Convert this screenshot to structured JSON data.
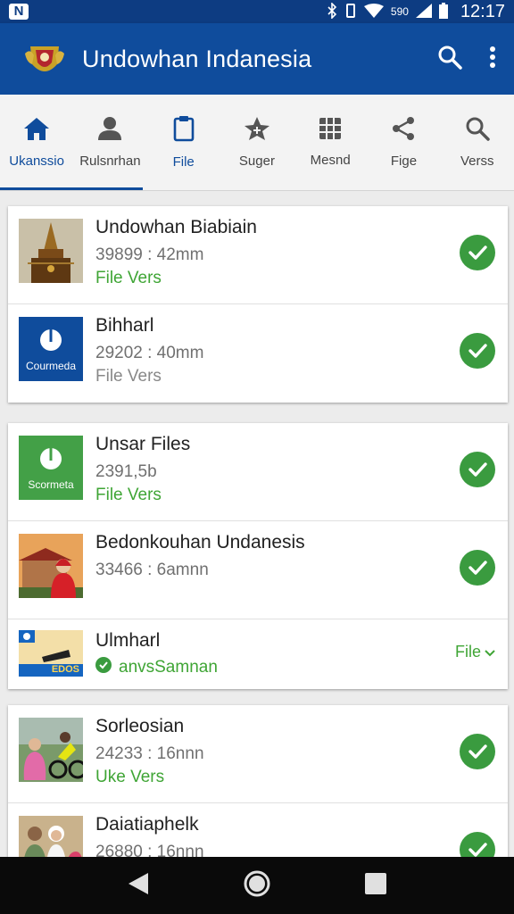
{
  "status": {
    "network": "590",
    "time": "12:17"
  },
  "appbar": {
    "title": "Undowhan Indanesia"
  },
  "tabs": [
    {
      "label": "Ukanssio",
      "icon": "home-icon"
    },
    {
      "label": "Rulsnrhan",
      "icon": "person-icon"
    },
    {
      "label": "File",
      "icon": "clipboard-icon"
    },
    {
      "label": "Suger",
      "icon": "star-icon"
    },
    {
      "label": "Mesnd",
      "icon": "grid-icon"
    },
    {
      "label": "Fige",
      "icon": "share-icon"
    },
    {
      "label": "Verss",
      "icon": "search-icon"
    }
  ],
  "cards": [
    {
      "rows": [
        {
          "title": "Undowhan Biabiain",
          "sub": "39899 : 42mm",
          "meta": "File Vers",
          "thumb": "temple-image"
        },
        {
          "title": "Bihharl",
          "sub": "29202 : 40mm",
          "meta": "File Vers",
          "thumb": "blue-logo",
          "thumb_text": "Courmeda"
        }
      ]
    },
    {
      "rows": [
        {
          "title": "Unsar Files",
          "sub": "2391,5b",
          "meta": "File Vers",
          "thumb": "green-logo",
          "thumb_text": "Scormeta"
        },
        {
          "title": "Bedonkouhan Undanesis",
          "sub": "33466 : 6amnn",
          "thumb": "building-photo"
        },
        {
          "title": "Ulmharl",
          "meta": "anvsSamnan",
          "thumb": "cleaner-image",
          "thumb_text": "EDOS",
          "action": "File"
        }
      ]
    },
    {
      "rows": [
        {
          "title": "Sorleosian",
          "sub": "24233 : 16nnn",
          "meta": "Uke Vers",
          "thumb": "motorbike-photo"
        },
        {
          "title": "Daiatiaphelk",
          "sub": "26880 : 16nnn",
          "thumb": "people-photo"
        }
      ]
    }
  ],
  "colors": {
    "primary": "#0f4c9c",
    "accent_green": "#3a9b3f",
    "meta_green": "#3fa535"
  }
}
